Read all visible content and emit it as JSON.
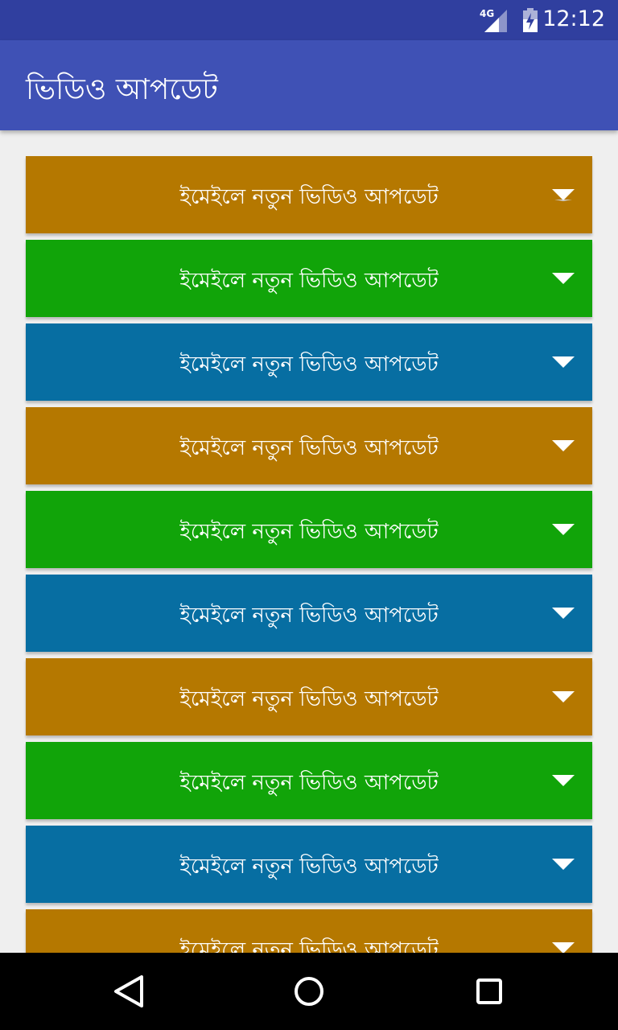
{
  "status_bar": {
    "network": "4G",
    "time": "12:12"
  },
  "app_bar": {
    "title": "ভিডিও আপডেট"
  },
  "list": {
    "items": [
      {
        "label": "ইমেইলে নতুন ভিডিও আপডেট",
        "color": "#b57800"
      },
      {
        "label": "ইমেইলে নতুন ভিডিও আপডেট",
        "color": "#11a409"
      },
      {
        "label": "ইমেইলে নতুন ভিডিও আপডেট",
        "color": "#076ea2"
      },
      {
        "label": "ইমেইলে নতুন ভিডিও আপডেট",
        "color": "#b57800"
      },
      {
        "label": "ইমেইলে নতুন ভিডিও আপডেট",
        "color": "#11a409"
      },
      {
        "label": "ইমেইলে নতুন ভিডিও আপডেট",
        "color": "#076ea2"
      },
      {
        "label": "ইমেইলে নতুন ভিডিও আপডেট",
        "color": "#b57800"
      },
      {
        "label": "ইমেইলে নতুন ভিডিও আপডেট",
        "color": "#11a409"
      },
      {
        "label": "ইমেইলে নতুন ভিডিও আপডেট",
        "color": "#076ea2"
      },
      {
        "label": "ইমেইলে নতুন ভিডিও আপডেট",
        "color": "#b57800"
      }
    ],
    "expand_icon": "triangle-down-icon"
  },
  "nav_bar": {
    "icons": [
      "back-icon",
      "home-icon",
      "recents-icon"
    ]
  }
}
